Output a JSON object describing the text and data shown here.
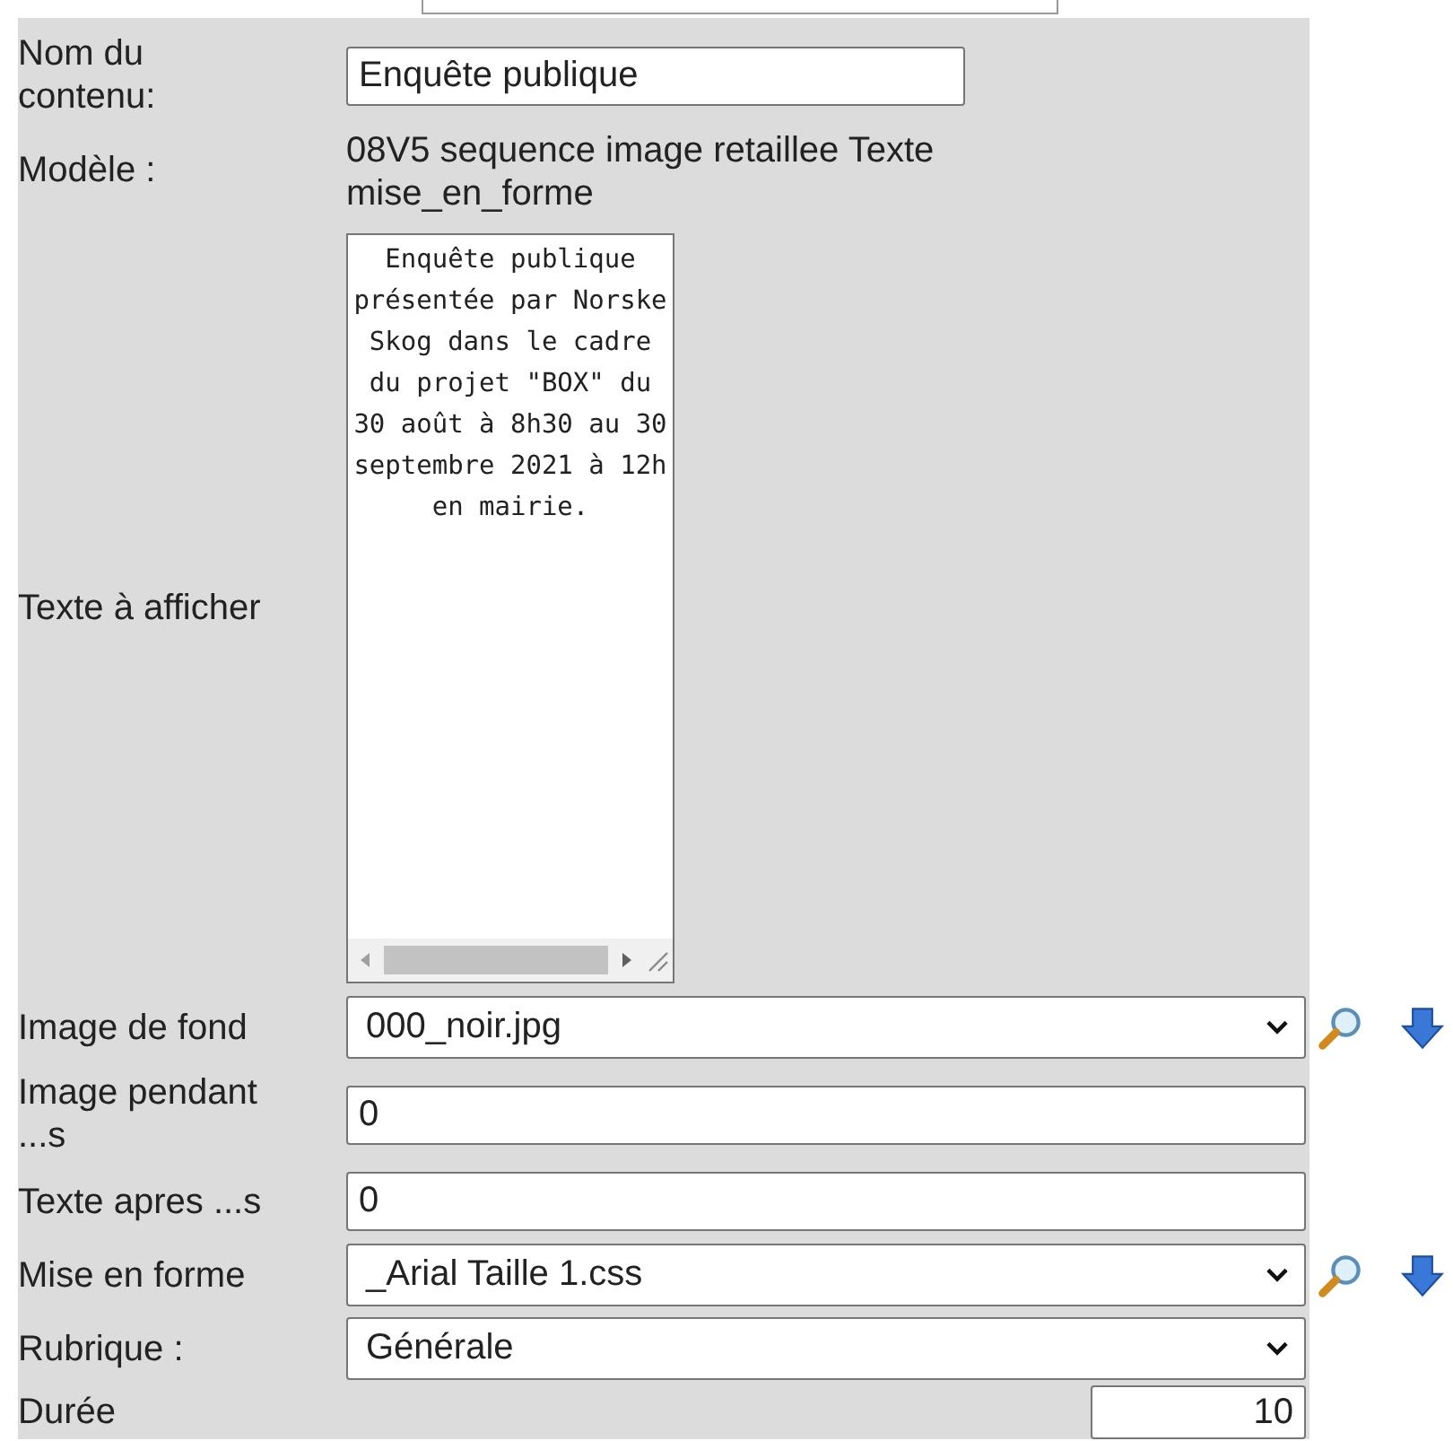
{
  "form": {
    "rows": [
      {
        "kind": "text",
        "label": "Nom du contenu:",
        "value": "Enquête publique"
      },
      {
        "kind": "static",
        "label": "Modèle :",
        "value": "08V5 sequence image retaillee Texte mise_en_forme"
      },
      {
        "kind": "textarea",
        "label": "Texte à afficher",
        "value": "Enquête publique présentée par Norske Skog dans le cadre du projet \"BOX\" du 30 août à 8h30 au 30 septembre 2021 à 12h en mairie."
      },
      {
        "kind": "select",
        "label": "Image de fond",
        "value": "000_noir.jpg",
        "actions": true
      },
      {
        "kind": "wide",
        "label": "Image pendant ...s",
        "value": "0"
      },
      {
        "kind": "wide",
        "label": "Texte apres ...s",
        "value": "0"
      },
      {
        "kind": "select",
        "label": "Mise en forme",
        "value": "_Arial Taille 1.css",
        "actions": true
      },
      {
        "kind": "select",
        "label": "Rubrique :",
        "value": "Générale",
        "actions": false
      },
      {
        "kind": "number",
        "label": "Durée",
        "value": "10"
      }
    ]
  }
}
